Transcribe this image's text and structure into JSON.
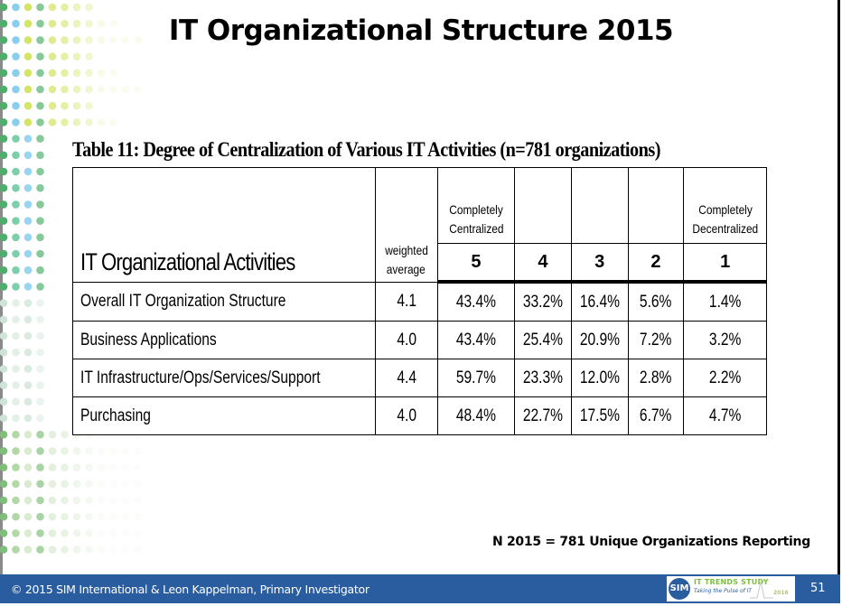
{
  "slide": {
    "title": "IT Organizational Structure 2015",
    "caption": "Table 11: Degree of Centralization of Various IT Activities (n=781 organizations)",
    "note": "N 2015 = 781 Unique Organizations Reporting"
  },
  "table": {
    "header": {
      "activities": "IT Organizational Activities",
      "weighted_line1": "weighted",
      "weighted_line2": "average",
      "centralized_line1": "Completely",
      "centralized_line2": "Centralized",
      "decentralized_line1": "Completely",
      "decentralized_line2": "Decentralized",
      "scale": [
        "5",
        "4",
        "3",
        "2",
        "1"
      ]
    },
    "rows": [
      {
        "activity": "Overall IT Organization Structure",
        "weighted_average": "4.1",
        "values": [
          "43.4%",
          "33.2%",
          "16.4%",
          "5.6%",
          "1.4%"
        ]
      },
      {
        "activity": "Business Applications",
        "weighted_average": "4.0",
        "values": [
          "43.4%",
          "25.4%",
          "20.9%",
          "7.2%",
          "3.2%"
        ]
      },
      {
        "activity": "IT Infrastructure/Ops/Services/Support",
        "weighted_average": "4.4",
        "values": [
          "59.7%",
          "23.3%",
          "12.0%",
          "2.8%",
          "2.2%"
        ]
      },
      {
        "activity": "Purchasing",
        "weighted_average": "4.0",
        "values": [
          "48.4%",
          "22.7%",
          "17.5%",
          "6.7%",
          "4.7%"
        ]
      }
    ]
  },
  "footer": {
    "copyright": "© 2015 SIM International & Leon Kappelman, Primary Investigator",
    "logo": {
      "circle_text": "SIM",
      "title": "IT TRENDS STUDY",
      "subtitle": "Taking the Pulse of IT",
      "year": "2016"
    },
    "page_number": "51"
  },
  "colors": {
    "footer_bg": "#2a5d9f",
    "logo_green": "#7bbf3c",
    "dot_green": "#4caf6a",
    "dot_blue": "#7cc8ec",
    "dot_yellow": "#c8dc3a"
  }
}
